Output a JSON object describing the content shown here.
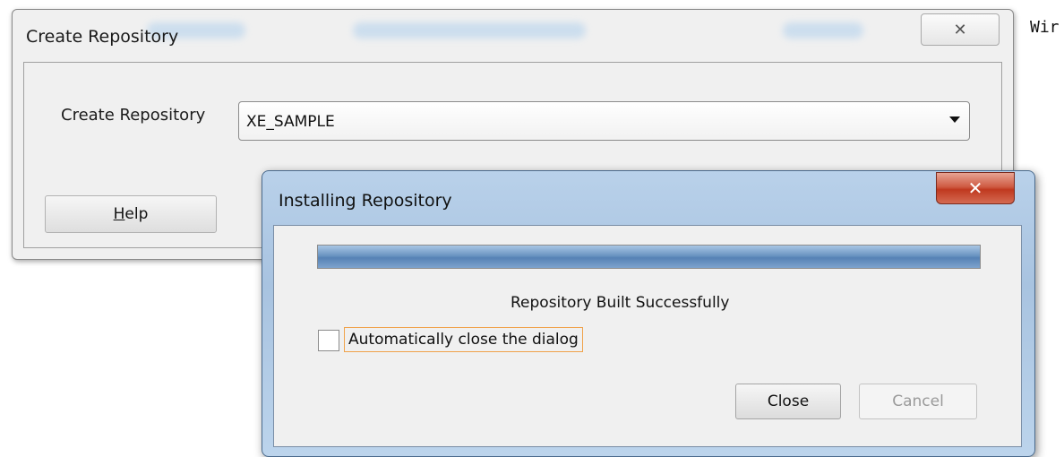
{
  "background": {
    "text": "Wir"
  },
  "create_dialog": {
    "title": "Create Repository",
    "close_glyph": "✕",
    "field_label": "Create Repository",
    "selected_value": "XE_SAMPLE",
    "help_prefix": "",
    "help_underlined": "H",
    "help_rest": "elp"
  },
  "install_dialog": {
    "title": "Installing Repository",
    "close_glyph": "✕",
    "progress_fraction": 1.0,
    "status": "Repository Built Successfully",
    "auto_close_label": "Automatically close the dialog",
    "auto_close_checked": false,
    "close_button": "Close",
    "cancel_button": "Cancel"
  },
  "colors": {
    "titlebar_aero": "#b9d1ea",
    "close_red": "#c0391f",
    "progress_blue": "#5682b5",
    "focus_orange": "#f0a24a"
  }
}
